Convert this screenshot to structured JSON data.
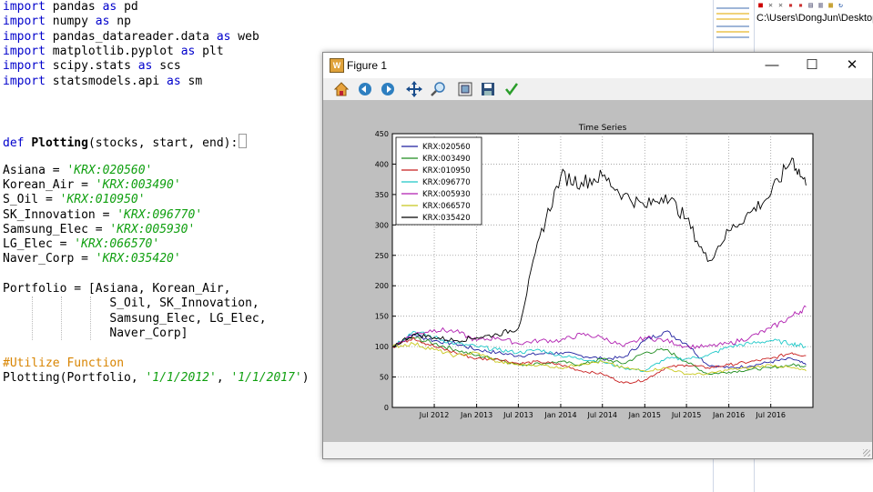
{
  "editor": {
    "code": {
      "import1": {
        "kw": "import",
        "mod": "pandas",
        "as_kw": "as",
        "alias": "pd"
      },
      "import2": {
        "kw": "import",
        "mod": "numpy",
        "as_kw": "as",
        "alias": "np"
      },
      "import3": {
        "kw": "import",
        "mod": "pandas_datareader.data",
        "as_kw": "as",
        "alias": "web"
      },
      "import4": {
        "kw": "import",
        "mod": "matplotlib.pyplot",
        "as_kw": "as",
        "alias": "plt"
      },
      "import5": {
        "kw": "import",
        "mod": "scipy.stats",
        "as_kw": "as",
        "alias": "scs"
      },
      "import6": {
        "kw": "import",
        "mod": "statsmodels.api",
        "as_kw": "as",
        "alias": "sm"
      },
      "def_kw": "def",
      "def_name": "Plotting",
      "def_args": "(stocks, start, end):",
      "assignments": [
        {
          "name": "Asiana = ",
          "value": "'KRX:020560'"
        },
        {
          "name": "Korean_Air = ",
          "value": "'KRX:003490'"
        },
        {
          "name": "S_Oil = ",
          "value": "'KRX:010950'"
        },
        {
          "name": "SK_Innovation = ",
          "value": "'KRX:096770'"
        },
        {
          "name": "Samsung_Elec = ",
          "value": "'KRX:005930'"
        },
        {
          "name": "LG_Elec = ",
          "value": "'KRX:066570'"
        },
        {
          "name": "Naver_Corp = ",
          "value": "'KRX:035420'"
        }
      ],
      "portfolio_lines": [
        "Portfolio = [Asiana, Korean_Air,",
        "               S_Oil, SK_Innovation,",
        "               Samsung_Elec, LG_Elec,",
        "               Naver_Corp]"
      ],
      "comment": "#Utilize Function",
      "call_prefix": "Plotting(Portfolio, ",
      "call_arg1": "'1/1/2012'",
      "call_sep": ", ",
      "call_arg2": "'1/1/2017'",
      "call_suffix": ")"
    }
  },
  "path_panel": {
    "path_text": "C:\\Users\\DongJun\\Desktop\\"
  },
  "figure_window": {
    "title": "Figure 1",
    "minimize": "—",
    "maximize": "☐",
    "close": "✕",
    "toolbar_icons": [
      "home-icon",
      "back-arrow-icon",
      "forward-arrow-icon",
      "pan-icon",
      "zoom-icon",
      "subplots-icon",
      "save-icon",
      "edit-check-icon"
    ]
  },
  "colors": {
    "keyword": "#0000cc",
    "string": "#11a011",
    "comment": "#d88400",
    "figure_background": "#bfbfbf"
  },
  "chart_data": {
    "type": "line",
    "title": "Time Series",
    "xlabel": "",
    "ylabel": "",
    "x_ticks": [
      "Jul 2012",
      "Jan 2013",
      "Jul 2013",
      "Jan 2014",
      "Jul 2014",
      "Jan 2015",
      "Jul 2015",
      "Jan 2016",
      "Jul 2016"
    ],
    "y_ticks": [
      "0",
      "50",
      "100",
      "150",
      "200",
      "250",
      "300",
      "350",
      "400",
      "450"
    ],
    "xlim": [
      "2012-01-01",
      "2016-12-31"
    ],
    "ylim": [
      0,
      450
    ],
    "grid": true,
    "legend_position": "top-left",
    "x_dates": [
      "2012-01",
      "2012-04",
      "2012-07",
      "2012-10",
      "2013-01",
      "2013-04",
      "2013-07",
      "2013-10",
      "2014-01",
      "2014-04",
      "2014-07",
      "2014-10",
      "2015-01",
      "2015-04",
      "2015-07",
      "2015-10",
      "2016-01",
      "2016-04",
      "2016-07",
      "2016-10",
      "2016-12"
    ],
    "series": [
      {
        "name": "KRX:020560",
        "color": "#1f1f9f",
        "values": [
          100,
          120,
          110,
          105,
          95,
          90,
          85,
          88,
          90,
          85,
          80,
          82,
          110,
          125,
          105,
          70,
          65,
          68,
          75,
          80,
          70
        ]
      },
      {
        "name": "KRX:003490",
        "color": "#1e8c1e",
        "values": [
          100,
          115,
          105,
          95,
          85,
          80,
          70,
          72,
          75,
          70,
          80,
          72,
          90,
          95,
          75,
          55,
          58,
          62,
          65,
          70,
          68
        ]
      },
      {
        "name": "KRX:010950",
        "color": "#c81e1e",
        "values": [
          100,
          115,
          100,
          90,
          80,
          80,
          72,
          75,
          70,
          60,
          55,
          40,
          45,
          65,
          70,
          65,
          70,
          75,
          80,
          90,
          85
        ]
      },
      {
        "name": "KRX:096770",
        "color": "#1ec8c8",
        "values": [
          100,
          125,
          115,
          105,
          100,
          95,
          90,
          95,
          85,
          80,
          75,
          65,
          60,
          80,
          80,
          85,
          100,
          105,
          110,
          105,
          100
        ]
      },
      {
        "name": "KRX:005930",
        "color": "#b01eb0",
        "values": [
          100,
          120,
          128,
          125,
          110,
          115,
          105,
          110,
          110,
          120,
          115,
          100,
          115,
          110,
          100,
          100,
          105,
          115,
          130,
          150,
          165
        ]
      },
      {
        "name": "KRX:066570",
        "color": "#c8c81e",
        "values": [
          100,
          105,
          95,
          85,
          90,
          75,
          70,
          70,
          65,
          72,
          75,
          65,
          60,
          65,
          55,
          55,
          62,
          65,
          70,
          65,
          60
        ]
      },
      {
        "name": "KRX:035420",
        "color": "#000000",
        "values": [
          100,
          120,
          115,
          110,
          115,
          120,
          130,
          280,
          380,
          370,
          380,
          350,
          330,
          350,
          310,
          240,
          290,
          320,
          350,
          410,
          365
        ]
      }
    ]
  }
}
